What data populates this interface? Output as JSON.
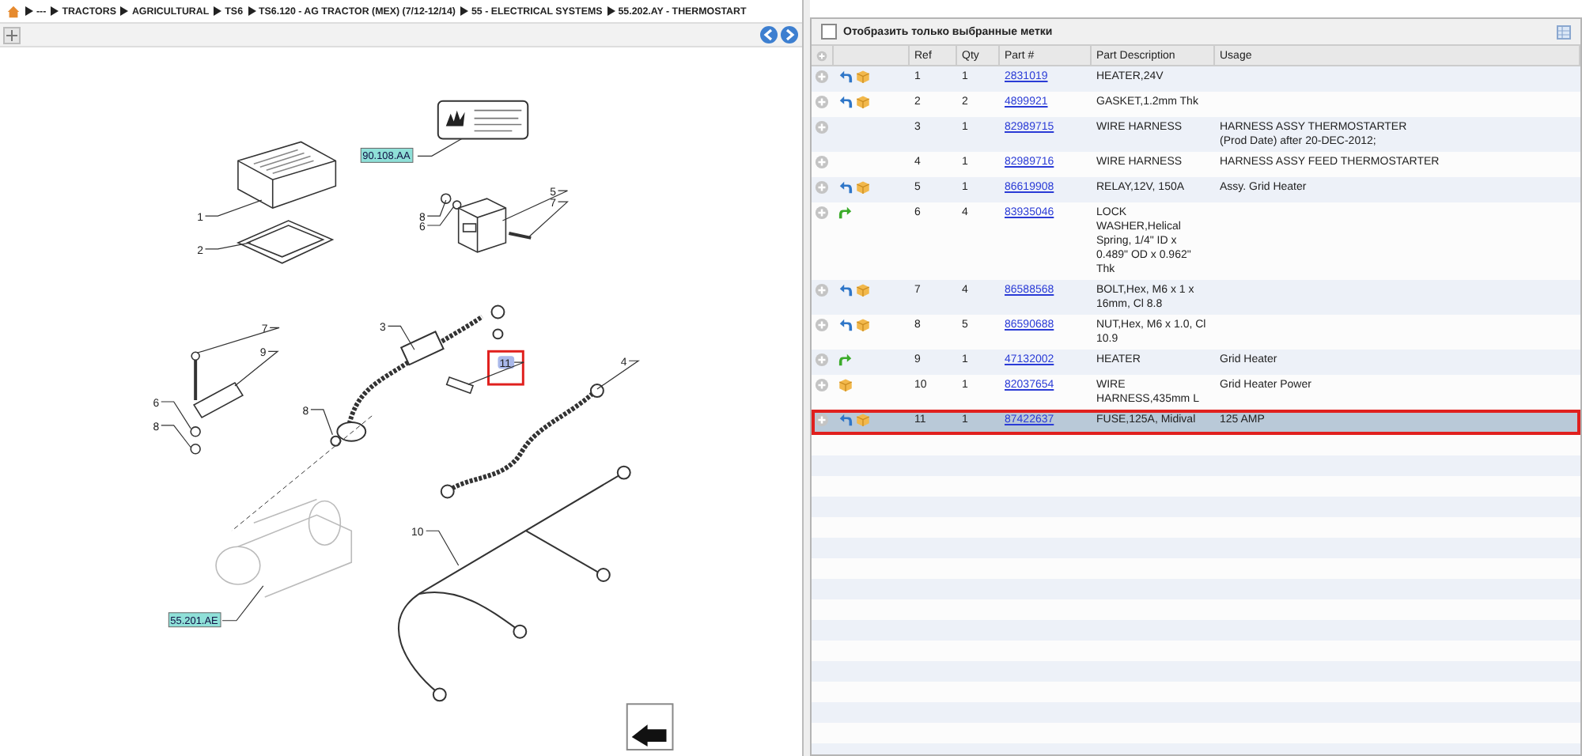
{
  "breadcrumb": [
    "---",
    "TRACTORS",
    "AGRICULTURAL",
    "TS6",
    "TS6.120 - AG TRACTOR (MEX) (7/12-12/14)",
    "55 - ELECTRICAL SYSTEMS",
    "55.202.AY - THERMOSTART"
  ],
  "diagram": {
    "callouts": [
      {
        "label": "1",
        "selected": false
      },
      {
        "label": "2",
        "selected": false
      },
      {
        "label": "8",
        "selected": false
      },
      {
        "label": "6",
        "selected": false
      },
      {
        "label": "5",
        "selected": false
      },
      {
        "label": "7",
        "selected": false
      },
      {
        "label": "3",
        "selected": false
      },
      {
        "label": "7",
        "selected": false
      },
      {
        "label": "9",
        "selected": false
      },
      {
        "label": "6",
        "selected": false
      },
      {
        "label": "8",
        "selected": false
      },
      {
        "label": "8",
        "selected": false
      },
      {
        "label": "11",
        "selected": true
      },
      {
        "label": "4",
        "selected": false
      },
      {
        "label": "10",
        "selected": false
      }
    ],
    "references": [
      "90.108.AA",
      "55.201.AE"
    ]
  },
  "filter": {
    "label": "Отобразить только выбранные метки",
    "checked": false
  },
  "table": {
    "columns": [
      "Ref",
      "Qty",
      "Part #",
      "Part Description",
      "Usage"
    ],
    "rows": [
      {
        "ref": "1",
        "qty": "1",
        "part": "2831019",
        "description": "HEATER,24V",
        "back_link": true,
        "forward_link": false,
        "package": true,
        "selected": false
      },
      {
        "ref": "2",
        "qty": "2",
        "part": "4899921",
        "description": "GASKET,1.2mm Thk",
        "back_link": true,
        "forward_link": false,
        "package": true,
        "selected": false
      },
      {
        "ref": "3",
        "qty": "1",
        "part": "82989715",
        "description": "WIRE HARNESS",
        "usage": [
          "HARNESS ASSY THERMOSTARTER",
          "(Prod Date) after 20-DEC-2012;"
        ],
        "back_link": false,
        "forward_link": false,
        "package": false,
        "selected": false
      },
      {
        "ref": "4",
        "qty": "1",
        "part": "82989716",
        "description": "WIRE HARNESS",
        "usage": [
          "HARNESS ASSY FEED THERMOSTARTER"
        ],
        "back_link": false,
        "forward_link": false,
        "package": false,
        "selected": false
      },
      {
        "ref": "5",
        "qty": "1",
        "part": "86619908",
        "description": "RELAY,12V, 150A",
        "usage": [
          "Assy. Grid Heater"
        ],
        "back_link": true,
        "forward_link": false,
        "package": true,
        "selected": false
      },
      {
        "ref": "6",
        "qty": "4",
        "part": "83935046",
        "description": "LOCK WASHER,Helical Spring, 1/4\" ID x 0.489\" OD x 0.962\" Thk",
        "back_link": false,
        "forward_link": true,
        "package": false,
        "selected": false
      },
      {
        "ref": "7",
        "qty": "4",
        "part": "86588568",
        "description": "BOLT,Hex, M6 x 1 x 16mm, Cl 8.8",
        "back_link": true,
        "forward_link": false,
        "package": true,
        "selected": false
      },
      {
        "ref": "8",
        "qty": "5",
        "part": "86590688",
        "description": "NUT,Hex, M6 x 1.0, Cl 10.9",
        "back_link": true,
        "forward_link": false,
        "package": true,
        "selected": false
      },
      {
        "ref": "9",
        "qty": "1",
        "part": "47132002",
        "description": "HEATER",
        "usage": [
          "Grid Heater"
        ],
        "back_link": false,
        "forward_link": true,
        "package": false,
        "selected": false
      },
      {
        "ref": "10",
        "qty": "1",
        "part": "82037654",
        "description": "WIRE HARNESS,435mm L",
        "usage": [
          "Grid Heater Power"
        ],
        "back_link": false,
        "forward_link": false,
        "package": true,
        "selected": false
      },
      {
        "ref": "11",
        "qty": "1",
        "part": "87422637",
        "description": "FUSE,125A, Midival",
        "usage": [
          "125 AMP"
        ],
        "back_link": true,
        "forward_link": false,
        "package": true,
        "selected": true
      }
    ]
  }
}
